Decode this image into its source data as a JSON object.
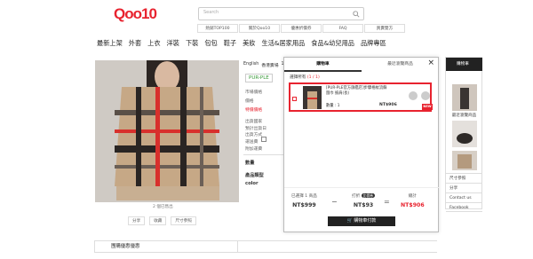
{
  "header": {
    "logo": "Qoo10",
    "search_placeholder": "Search",
    "quick_links": [
      "熱銷TOP100",
      "關於Qoo10",
      "優惠折價券",
      "FAQ",
      "買賣雙方"
    ]
  },
  "categories": [
    "最新上架",
    "外套",
    "上衣",
    "洋裝",
    "下裝",
    "包包",
    "鞋子",
    "美妝",
    "生活&居家用品",
    "食品&幼兒用品",
    "品牌專區"
  ],
  "product": {
    "language": "English",
    "tabs": [
      "香港賣場",
      "1/3"
    ],
    "brand": "PUR-PLE",
    "labels": [
      "市場價格",
      "價格",
      "特價價格",
      "出貨國家",
      "預計出貨日",
      "出貨方式",
      "運送費",
      "附加運費",
      "數量",
      "產品類型",
      "color"
    ],
    "image_caption": "2 個已售出",
    "share_buttons": [
      "分享",
      "收藏",
      "尺寸參照"
    ],
    "section_tab": "團購優惠優惠"
  },
  "cart_popup": {
    "tab_cart": "購物車",
    "tab_recent": "最近瀏覽商品",
    "select_all": "選擇所有",
    "count": "(1 / 1)",
    "item": {
      "title": "[PUR-PLE官方旗艦店]步驟格紋流蘇圍巾 披肩(長)",
      "qty": "數量 : 1",
      "price": "NT$906",
      "badge": "NEW"
    },
    "summary": {
      "selected_label": "已選擇 1 商品",
      "selected_value": "NT$999",
      "discount_label": "打折",
      "discount_badge": "比價券",
      "discount_value": "NT$93",
      "total_label": "總計",
      "total_value": "NT$906"
    },
    "checkout": "購物車付款",
    "close": "×"
  },
  "right_sidebar": {
    "head": "購物車",
    "recent": "最近瀏覽商品",
    "size": "尺寸參照",
    "share": "分享",
    "contact": "Contact us",
    "facebook": "Facebook"
  },
  "colors": {
    "accent": "#e8232f",
    "dark": "#222222"
  }
}
